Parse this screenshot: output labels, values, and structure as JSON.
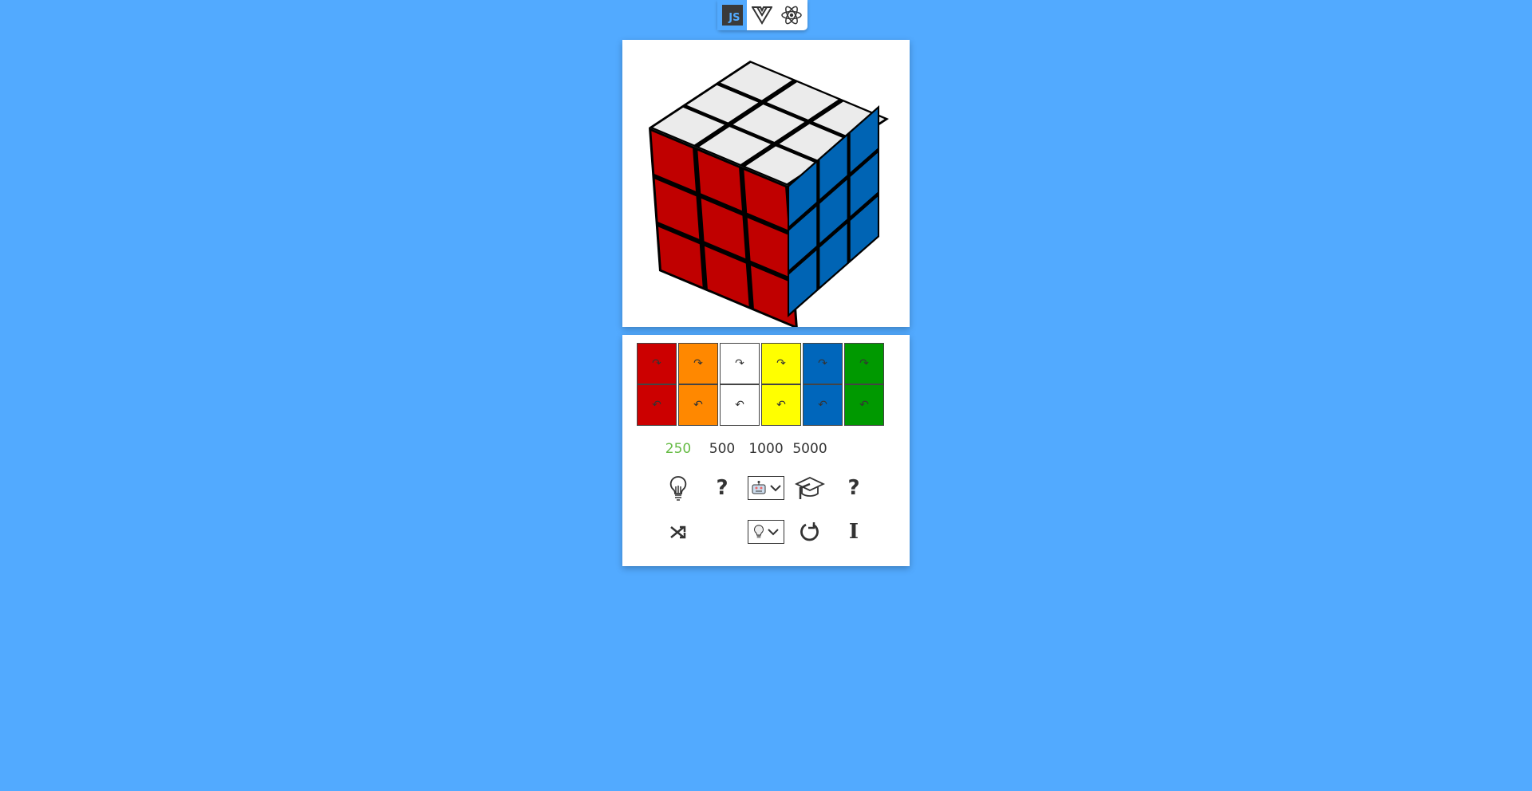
{
  "framework_switcher": {
    "items": [
      {
        "name": "js",
        "label": "JS",
        "active": true
      },
      {
        "name": "vue",
        "active": false
      },
      {
        "name": "react",
        "active": false
      }
    ]
  },
  "cube": {
    "faces": {
      "top": "#ebebeb",
      "front": "#c00000",
      "right": "#0064b4"
    }
  },
  "rotation_buttons": [
    {
      "color": "#cc0000",
      "cw": "↷",
      "ccw": "↶"
    },
    {
      "color": "#ff8800",
      "cw": "↷",
      "ccw": "↶"
    },
    {
      "color": "#ffffff",
      "cw": "↷",
      "ccw": "↶"
    },
    {
      "color": "#ffff00",
      "cw": "↷",
      "ccw": "↶"
    },
    {
      "color": "#0066bb",
      "cw": "↷",
      "ccw": "↶"
    },
    {
      "color": "#009900",
      "cw": "↷",
      "ccw": "↶"
    }
  ],
  "speeds": {
    "items": [
      "250",
      "500",
      "1000",
      "5000"
    ],
    "selected": "250",
    "selected_color": "#66bb44"
  },
  "toolbar": {
    "help1": "?",
    "help2": "?",
    "cursor": "I"
  }
}
